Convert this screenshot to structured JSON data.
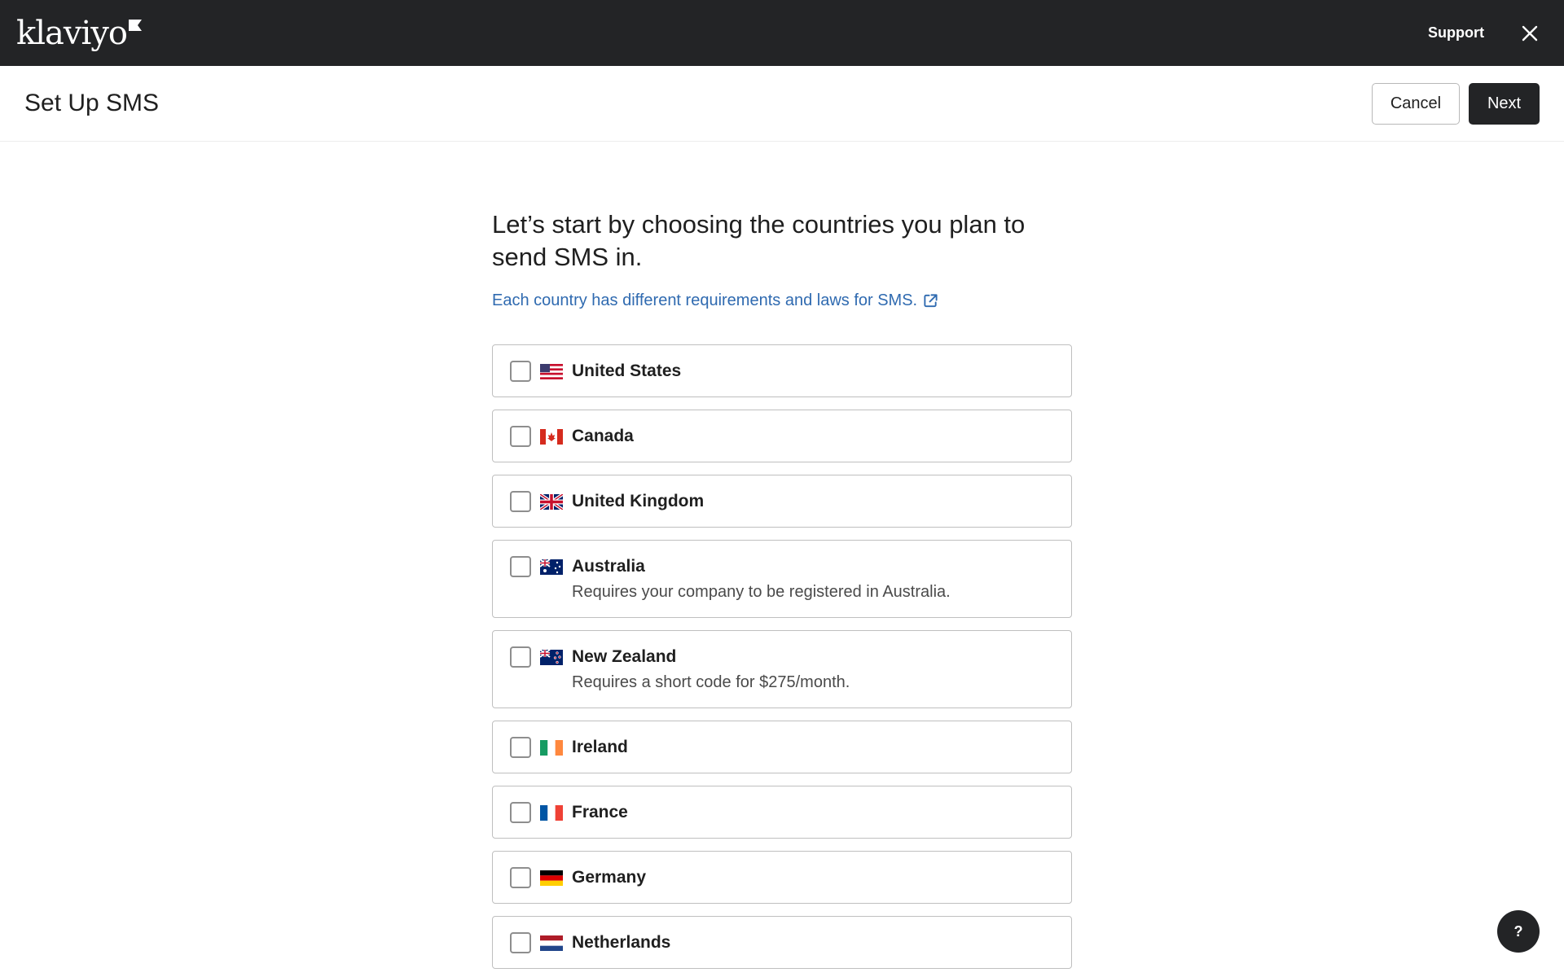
{
  "app": {
    "logo_text": "klaviyo"
  },
  "topbar": {
    "support_label": "Support",
    "close_icon": "close-icon"
  },
  "header": {
    "title": "Set Up SMS",
    "cancel_label": "Cancel",
    "next_label": "Next"
  },
  "main": {
    "headline": "Let’s start by choosing the countries you plan to send SMS in.",
    "info_link": "Each country has different requirements and laws for SMS.",
    "countries": [
      {
        "name": "United States",
        "note": "",
        "flag": "us-flag-icon",
        "checked": false
      },
      {
        "name": "Canada",
        "note": "",
        "flag": "canada-flag-icon",
        "checked": false
      },
      {
        "name": "United Kingdom",
        "note": "",
        "flag": "uk-flag-icon",
        "checked": false
      },
      {
        "name": "Australia",
        "note": "Requires your company to be registered in Australia.",
        "flag": "australia-flag-icon",
        "checked": false
      },
      {
        "name": "New Zealand",
        "note": "Requires a short code for $275/month.",
        "flag": "new-zealand-flag-icon",
        "checked": false
      },
      {
        "name": "Ireland",
        "note": "",
        "flag": "ireland-flag-icon",
        "checked": false
      },
      {
        "name": "France",
        "note": "",
        "flag": "france-flag-icon",
        "checked": false
      },
      {
        "name": "Germany",
        "note": "",
        "flag": "germany-flag-icon",
        "checked": false
      },
      {
        "name": "Netherlands",
        "note": "",
        "flag": "netherlands-flag-icon",
        "checked": false
      }
    ]
  },
  "help": {
    "label": "?"
  },
  "colors": {
    "topbar": "#232426",
    "link": "#2f6ab0",
    "border": "#bfbfbf",
    "primary_button": "#232426"
  }
}
